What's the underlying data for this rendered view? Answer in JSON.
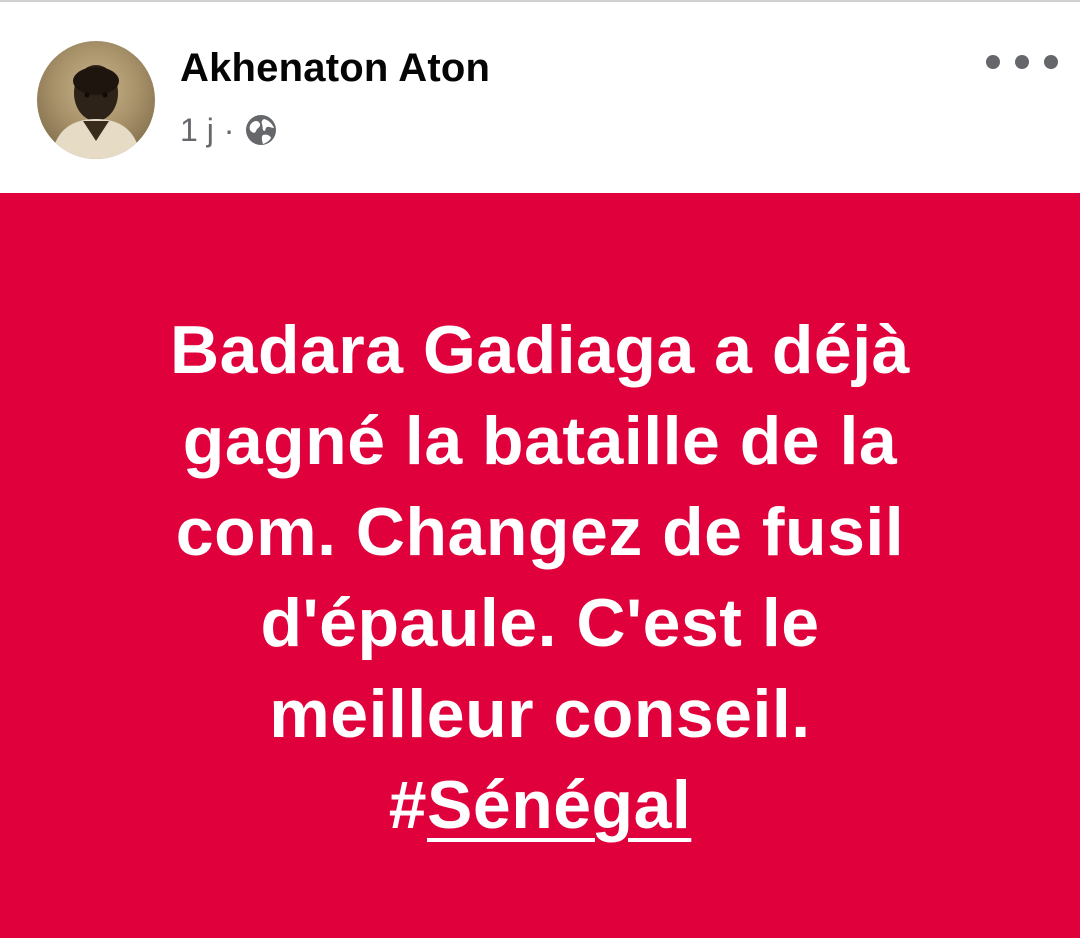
{
  "post": {
    "author_name": "Akhenaton Aton",
    "timestamp": "1 j",
    "separator": "·",
    "privacy_icon": "globe-icon",
    "more_icon": "more-options-icon",
    "text_lines": [
      "Badara Gadiaga a déjà",
      "gagné la bataille de la",
      "com. Changez de fusil",
      "d'épaule. C'est le",
      "meilleur conseil."
    ],
    "hashtag_symbol": "#",
    "hashtag_word": "Sénégal",
    "background_color": "#e0003c",
    "text_color": "#ffffff"
  }
}
